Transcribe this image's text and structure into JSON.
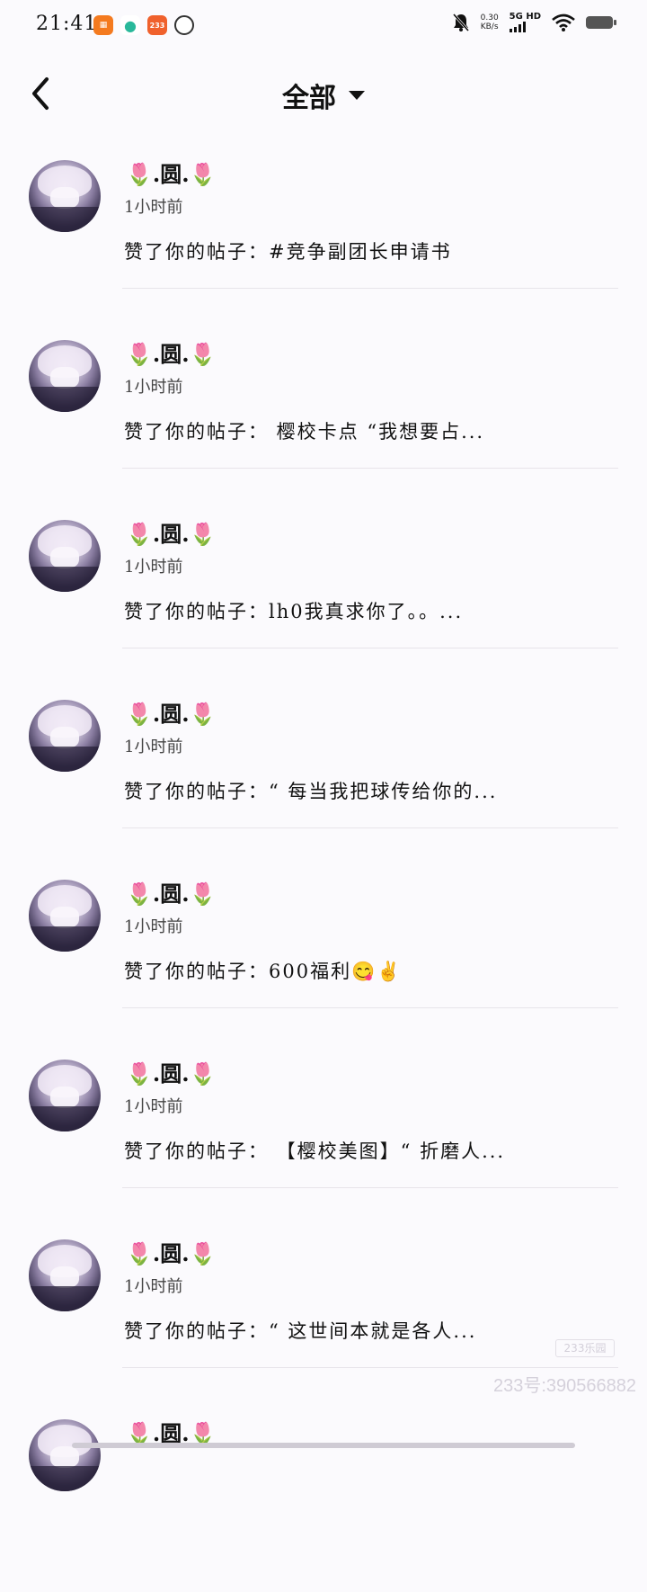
{
  "status_bar": {
    "time": "21:41",
    "app_icons": [
      "app-icon-1",
      "app-icon-2",
      "233",
      "app-icon-4"
    ],
    "network_speed_value": "0.30",
    "network_speed_unit": "KB/s",
    "network_type": "5G HD"
  },
  "header": {
    "title": "全部"
  },
  "notifications": [
    {
      "username_prefix": "🌷",
      "username": ".圆.",
      "username_suffix": "🌷",
      "time": "1小时前",
      "message": "赞了你的帖子：#竞争副团长申请书"
    },
    {
      "username_prefix": "🌷",
      "username": ".圆.",
      "username_suffix": "🌷",
      "time": "1小时前",
      "message": "赞了你的帖子： 樱校卡点 “我想要占..."
    },
    {
      "username_prefix": "🌷",
      "username": ".圆.",
      "username_suffix": "🌷",
      "time": "1小时前",
      "message": "赞了你的帖子：lh0我真求你了。。..."
    },
    {
      "username_prefix": "🌷",
      "username": ".圆.",
      "username_suffix": "🌷",
      "time": "1小时前",
      "message": "赞了你的帖子：“ 每当我把球传给你的..."
    },
    {
      "username_prefix": "🌷",
      "username": ".圆.",
      "username_suffix": "🌷",
      "time": "1小时前",
      "message": "赞了你的帖子：600福利😋✌"
    },
    {
      "username_prefix": "🌷",
      "username": ".圆.",
      "username_suffix": "🌷",
      "time": "1小时前",
      "message": "赞了你的帖子： 【樱校美图】“ 折磨人..."
    },
    {
      "username_prefix": "🌷",
      "username": ".圆.",
      "username_suffix": "🌷",
      "time": "1小时前",
      "message": "赞了你的帖子：“ 这世间本就是各人..."
    },
    {
      "username_prefix": "🌷",
      "username": ".圆.",
      "username_suffix": "🌷",
      "time": "",
      "message": ""
    }
  ],
  "watermark": {
    "logo": "233乐园",
    "id_text": "233号:390566882"
  }
}
